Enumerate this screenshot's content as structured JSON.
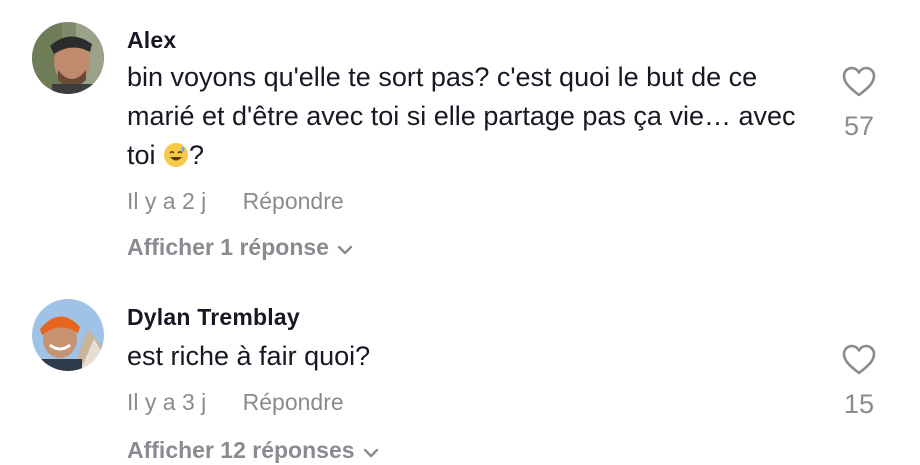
{
  "comments": [
    {
      "username": "Alex",
      "text": "bin voyons qu'elle te sort pas? c'est quoi le but de ce marié et d'être avec toi si elle partage pas ça vie… avec toi ",
      "text_after_emoji": "?",
      "emoji": "sweat-smile-emoji",
      "time": "Il y a 2 j",
      "reply_label": "Répondre",
      "view_replies_label": "Afficher 1 réponse",
      "likes": "57"
    },
    {
      "username": "Dylan Tremblay",
      "text": "est riche à fair quoi?",
      "time": "Il y a 3 j",
      "reply_label": "Répondre",
      "view_replies_label": "Afficher 12 réponses",
      "likes": "15"
    }
  ],
  "icons": {
    "like": "heart-outline-icon",
    "expand": "chevron-down-icon"
  },
  "colors": {
    "text_primary": "#161823",
    "text_secondary": "#8a8b91"
  }
}
